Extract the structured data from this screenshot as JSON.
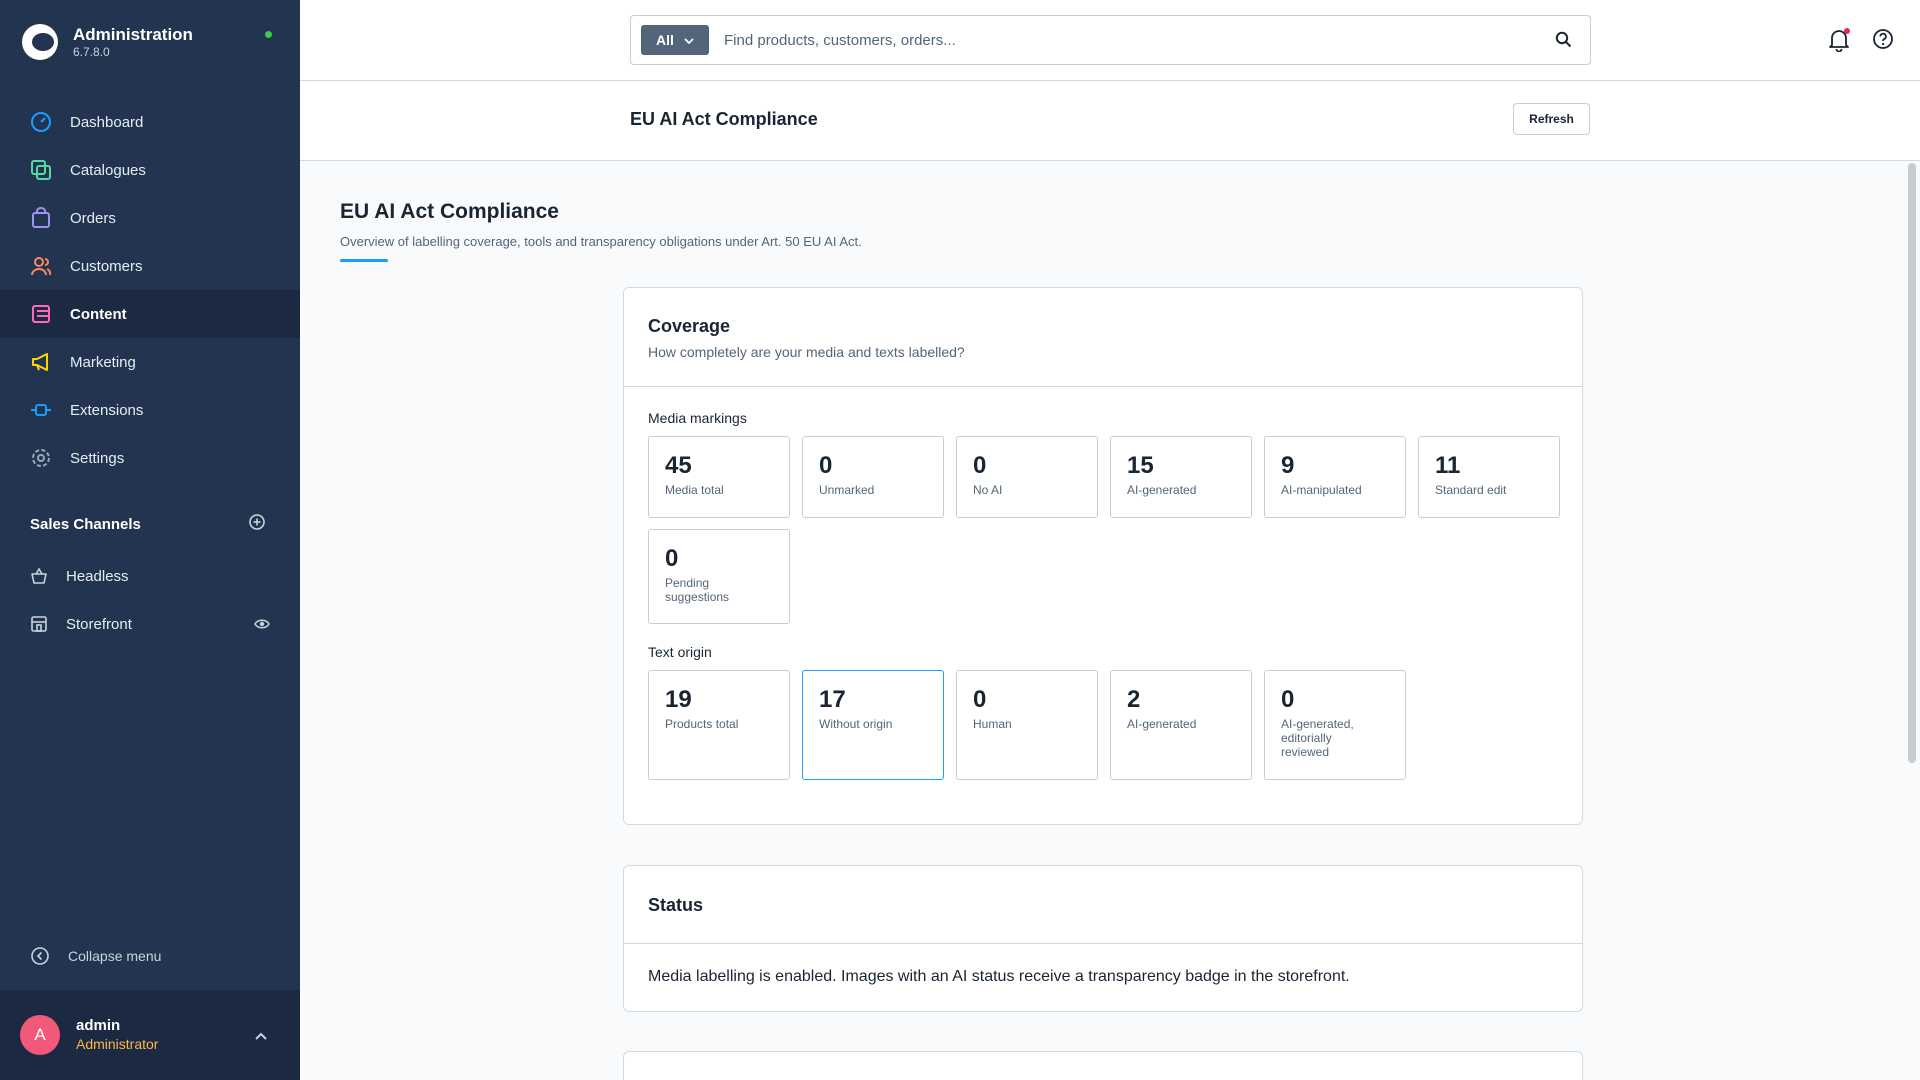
{
  "app": {
    "name": "Administration",
    "version": "6.7.8.0"
  },
  "nav": {
    "items": [
      {
        "label": "Dashboard",
        "icon": "dashboard-icon",
        "color": "#189eff"
      },
      {
        "label": "Catalogues",
        "icon": "catalogue-icon",
        "color": "#57d9a3"
      },
      {
        "label": "Orders",
        "icon": "orders-icon",
        "color": "#a092f0"
      },
      {
        "label": "Customers",
        "icon": "customers-icon",
        "color": "#f88962"
      },
      {
        "label": "Content",
        "icon": "content-icon",
        "color": "#ff68b4"
      },
      {
        "label": "Marketing",
        "icon": "marketing-icon",
        "color": "#ffd700"
      },
      {
        "label": "Extensions",
        "icon": "extensions-icon",
        "color": "#189eff"
      },
      {
        "label": "Settings",
        "icon": "settings-icon",
        "color": "#9aa8b5"
      }
    ],
    "active": "Content"
  },
  "sales_channels": {
    "title": "Sales Channels",
    "items": [
      {
        "label": "Headless",
        "icon": "basket-icon"
      },
      {
        "label": "Storefront",
        "icon": "storefront-icon"
      }
    ]
  },
  "collapse_label": "Collapse menu",
  "user": {
    "initial": "A",
    "name": "admin",
    "role": "Administrator"
  },
  "search": {
    "filter_label": "All",
    "placeholder": "Find products, customers, orders..."
  },
  "page_header": {
    "title": "EU AI Act Compliance",
    "refresh_label": "Refresh"
  },
  "content": {
    "title": "EU AI Act Compliance",
    "subtitle": "Overview of labelling coverage, tools and transparency obligations under Art. 50 EU AI Act."
  },
  "coverage": {
    "title": "Coverage",
    "subtitle": "How completely are your media and texts labelled?",
    "media_label": "Media markings",
    "media": [
      {
        "value": "45",
        "label": "Media total"
      },
      {
        "value": "0",
        "label": "Unmarked"
      },
      {
        "value": "0",
        "label": "No AI"
      },
      {
        "value": "15",
        "label": "AI-generated"
      },
      {
        "value": "9",
        "label": "AI-manipulated"
      },
      {
        "value": "11",
        "label": "Standard edit"
      },
      {
        "value": "0",
        "label": "Pending suggestions"
      }
    ],
    "text_label": "Text origin",
    "text": [
      {
        "value": "19",
        "label": "Products total"
      },
      {
        "value": "17",
        "label": "Without origin"
      },
      {
        "value": "0",
        "label": "Human"
      },
      {
        "value": "2",
        "label": "AI-generated"
      },
      {
        "value": "0",
        "label": "AI-generated, editorially reviewed"
      }
    ]
  },
  "status": {
    "title": "Status",
    "text": "Media labelling is enabled. Images with an AI status receive a transparency badge in the storefront."
  },
  "colors": {
    "sidebar": "#233450",
    "accent": "#189eff",
    "online": "#37d046",
    "avatar": "#f2587a",
    "role": "#ffb64b"
  }
}
